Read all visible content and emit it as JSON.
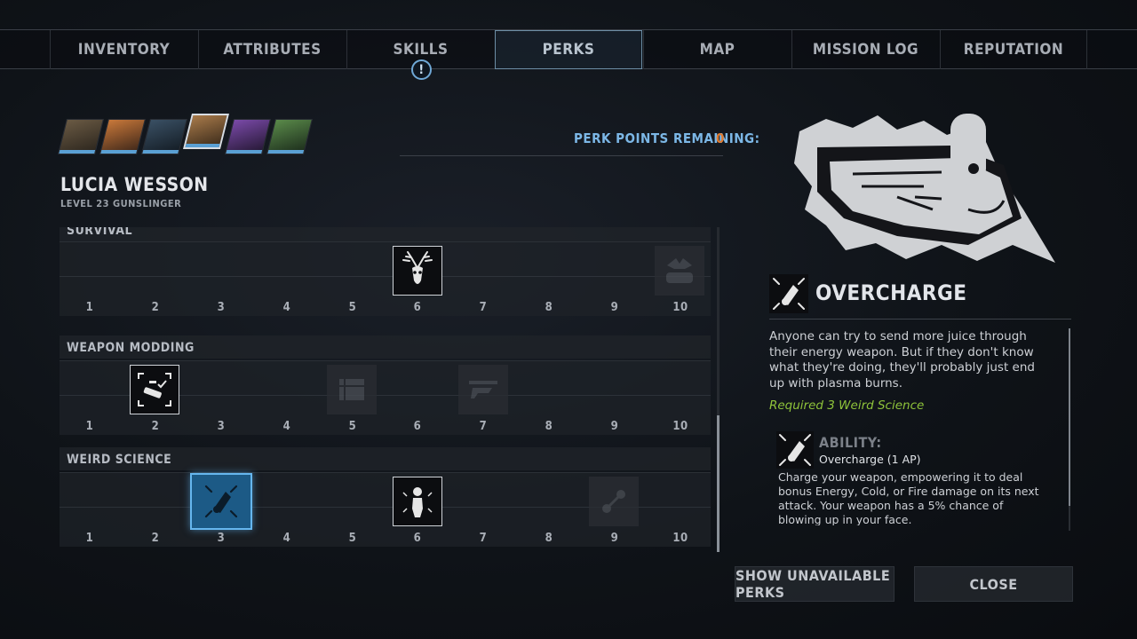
{
  "nav": {
    "tabs": [
      {
        "label": "INVENTORY"
      },
      {
        "label": "ATTRIBUTES"
      },
      {
        "label": "SKILLS",
        "alert": "!"
      },
      {
        "label": "PERKS",
        "active": true
      },
      {
        "label": "MAP"
      },
      {
        "label": "MISSION LOG"
      },
      {
        "label": "REPUTATION"
      }
    ]
  },
  "party": {
    "members": [
      {
        "portrait": "armored-soldier",
        "tone": "#4a3a2c"
      },
      {
        "portrait": "red-haired-woman",
        "tone": "#a8582c"
      },
      {
        "portrait": "robot-companion",
        "tone": "#2c3a48"
      },
      {
        "portrait": "lucia-wesson",
        "tone": "#7a5a3a",
        "selected": true
      },
      {
        "portrait": "purple-haired-man",
        "tone": "#5a3a7a"
      },
      {
        "portrait": "green-skinned-woman",
        "tone": "#3a5a3a"
      }
    ],
    "selected_color": "#5aa0d4"
  },
  "perk_points": {
    "label": "PERK POINTS REMAINING:",
    "value": "0"
  },
  "character": {
    "name": "LUCIA WESSON",
    "subtitle": "LEVEL 23 GUNSLINGER"
  },
  "trees": [
    {
      "title": "SURVIVAL",
      "levels": [
        "1",
        "2",
        "3",
        "4",
        "5",
        "6",
        "7",
        "8",
        "9",
        "10"
      ],
      "perks": [
        {
          "level": 6,
          "state": "owned",
          "icon": "deer-skull-icon"
        },
        {
          "level": 10,
          "state": "locked",
          "icon": "bear-trap-icon"
        }
      ]
    },
    {
      "title": "WEAPON MODDING",
      "levels": [
        "1",
        "2",
        "3",
        "4",
        "5",
        "6",
        "7",
        "8",
        "9",
        "10"
      ],
      "perks": [
        {
          "level": 2,
          "state": "owned",
          "icon": "scope-target-icon"
        },
        {
          "level": 5,
          "state": "locked",
          "icon": "crate-icon"
        },
        {
          "level": 7,
          "state": "locked",
          "icon": "rifle-mod-icon"
        }
      ]
    },
    {
      "title": "WEIRD SCIENCE",
      "levels": [
        "1",
        "2",
        "3",
        "4",
        "5",
        "6",
        "7",
        "8",
        "9",
        "10"
      ],
      "perks": [
        {
          "level": 3,
          "state": "selected",
          "icon": "overcharge-icon"
        },
        {
          "level": 6,
          "state": "owned",
          "icon": "mutant-figure-icon"
        },
        {
          "level": 9,
          "state": "locked",
          "icon": "molecule-icon"
        }
      ]
    }
  ],
  "detail": {
    "perk_name": "OVERCHARGE",
    "description": "Anyone can try to send more juice through their energy weapon. But if they don't know what they're doing, they'll probably just end up with plasma burns.",
    "requirement": "Required 3 Weird Science",
    "ability": {
      "label": "ABILITY:",
      "name": "Overcharge (1 AP)",
      "description": "Charge your weapon, empowering it to deal bonus Energy, Cold, or Fire damage on its next attack. Your weapon has a 5% chance of blowing up in your face."
    }
  },
  "buttons": {
    "show_unavailable": "SHOW UNAVAILABLE PERKS",
    "close": "CLOSE"
  },
  "colors": {
    "accent_blue": "#5aa0d4",
    "points_orange": "#e07a2e",
    "requirement_green": "#8fc43a"
  }
}
